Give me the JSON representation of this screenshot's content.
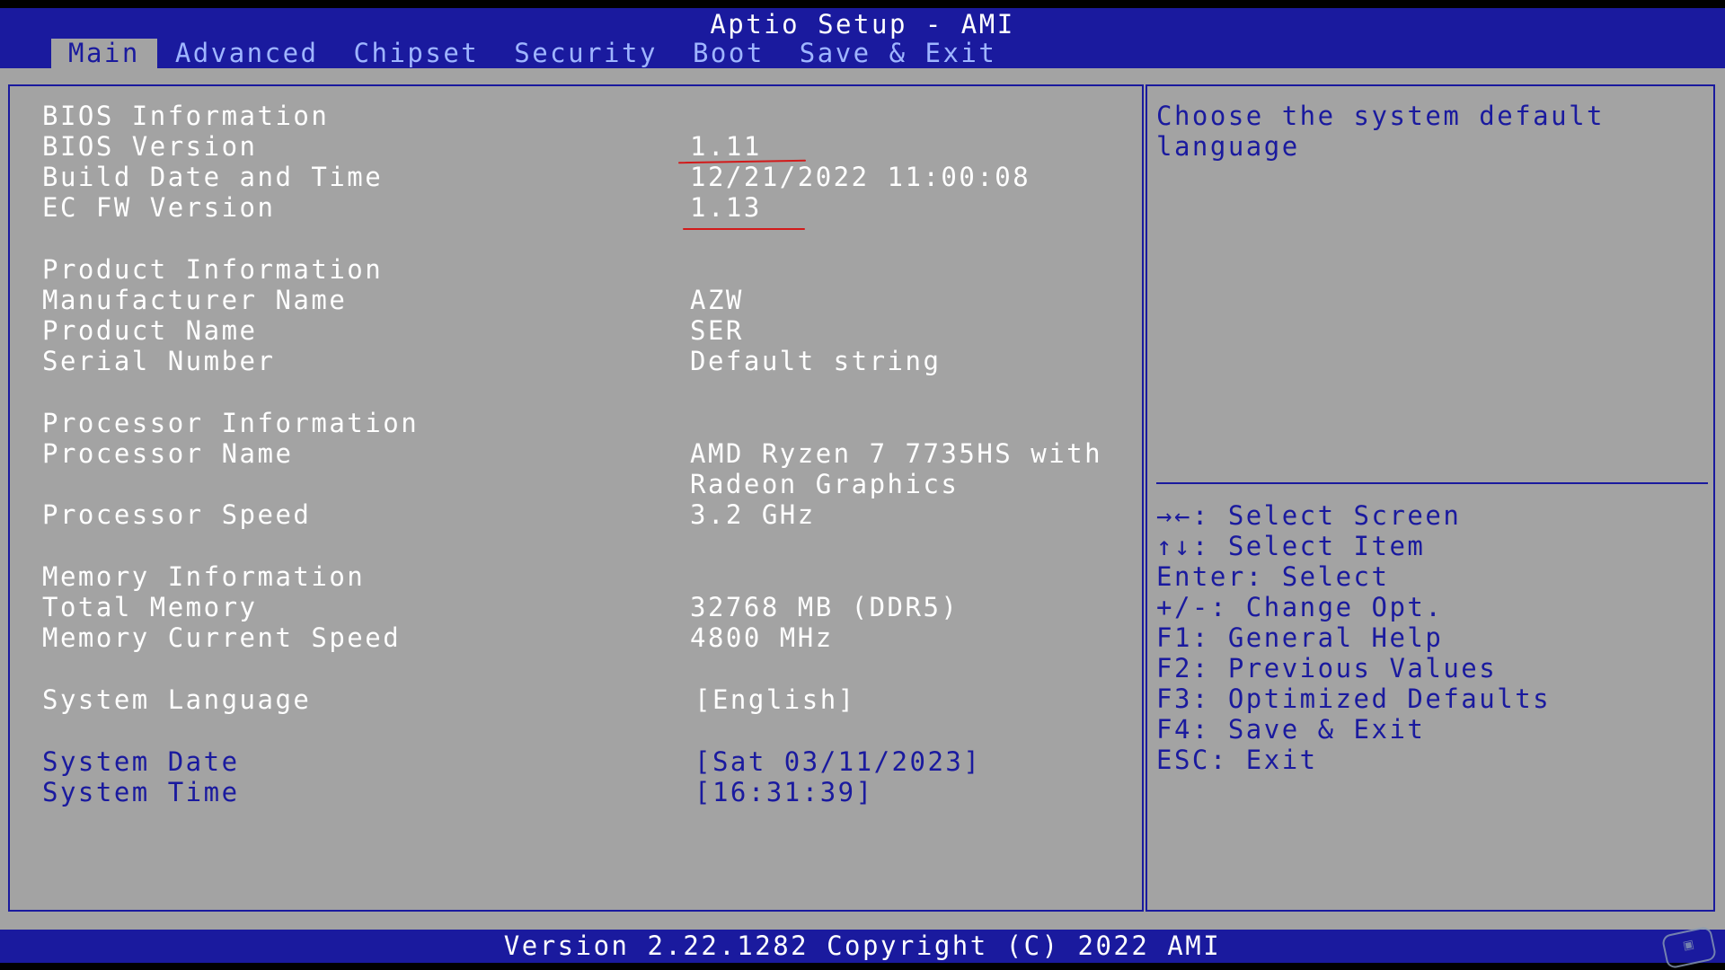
{
  "app": {
    "title": "Aptio Setup - AMI"
  },
  "tabs": [
    {
      "label": "Main",
      "active": true
    },
    {
      "label": "Advanced"
    },
    {
      "label": "Chipset"
    },
    {
      "label": "Security"
    },
    {
      "label": "Boot"
    },
    {
      "label": "Save & Exit"
    }
  ],
  "bios": {
    "heading": "BIOS Information",
    "version_label": "BIOS Version",
    "version": "1.11",
    "build_label": "Build Date and Time",
    "build": "12/21/2022 11:00:08",
    "ec_label": "EC FW Version",
    "ec": "1.13"
  },
  "product": {
    "heading": "Product Information",
    "manufacturer_label": "Manufacturer Name",
    "manufacturer": "AZW",
    "name_label": "Product Name",
    "name": "SER",
    "serial_label": "Serial Number",
    "serial": "Default string"
  },
  "processor": {
    "heading": "Processor Information",
    "name_label": "Processor Name",
    "name_line1": "AMD Ryzen 7 7735HS with",
    "name_line2": "Radeon Graphics",
    "speed_label": "Processor Speed",
    "speed": "3.2 GHz"
  },
  "memory": {
    "heading": "Memory Information",
    "total_label": "Total Memory",
    "total": "32768 MB (DDR5)",
    "speed_label": "Memory Current Speed",
    "speed": "4800 MHz"
  },
  "settings": {
    "language_label": "System Language",
    "language": "[English]",
    "date_label": "System Date",
    "date": "[Sat 03/11/2023]",
    "time_label": "System Time",
    "time": "[16:31:39]"
  },
  "help": {
    "text": "Choose the system default language"
  },
  "keys": [
    "→←: Select Screen",
    "↑↓: Select Item",
    "Enter: Select",
    "+/-: Change Opt.",
    "F1: General Help",
    "F2: Previous Values",
    "F3: Optimized Defaults",
    "F4: Save & Exit",
    "ESC: Exit"
  ],
  "footer": {
    "text": "Version 2.22.1282 Copyright (C) 2022 AMI"
  },
  "colors": {
    "bar": "#1a1a9e",
    "panel": "#a3a3a3",
    "inactive_tab": "#9fb5ff",
    "annotation": "#d21a1a"
  }
}
